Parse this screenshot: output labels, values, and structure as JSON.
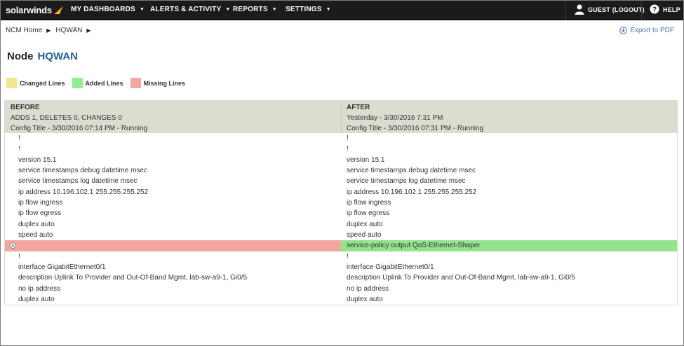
{
  "brand": {
    "name": "solarwinds"
  },
  "nav": {
    "items": [
      {
        "label": "MY DASHBOARDS"
      },
      {
        "label": "ALERTS & ACTIVITY"
      },
      {
        "label": "REPORTS"
      },
      {
        "label": "SETTINGS"
      }
    ],
    "user_label": "GUEST (LOGOUT)",
    "help_label": "HELP"
  },
  "breadcrumb": [
    "NCM Home",
    "HQWAN"
  ],
  "export_label": "Export to PDF",
  "page": {
    "title_prefix": "Node",
    "node_name": "HQWAN"
  },
  "legend": [
    {
      "label": "Changed Lines",
      "color": "#f0e68c"
    },
    {
      "label": "Added Lines",
      "color": "#90ee90"
    },
    {
      "label": "Missing Lines",
      "color": "#f4a6a6"
    }
  ],
  "diff": {
    "before": {
      "title": "BEFORE",
      "summary": "ADDS 1, DELETES 0, CHANGES 0",
      "config": "Config Title - 3/30/2016 07:14 PM - Running"
    },
    "after": {
      "title": "AFTER",
      "summary": "Yesterday - 3/30/2016 7:31 PM",
      "config": "Config Title - 3/30/2016 07:31 PM - Running"
    },
    "rows": [
      {
        "left": "!",
        "right": "!"
      },
      {
        "left": "!",
        "right": "!"
      },
      {
        "left": "version 15.1",
        "right": "version 15.1"
      },
      {
        "left": "service timestamps debug datetime msec",
        "right": "service timestamps debug datetime msec"
      },
      {
        "left": "service timestamps log datetime msec",
        "right": "service timestamps log datetime msec"
      },
      {
        "left": "ip address 10.196.102.1 255.255.255.252",
        "right": "ip address 10.196.102.1 255.255.255.252"
      },
      {
        "left": "ip flow ingress",
        "right": "ip flow ingress"
      },
      {
        "left": "ip flow egress",
        "right": "ip flow egress"
      },
      {
        "left": "duplex auto",
        "right": "duplex auto"
      },
      {
        "left": "speed auto",
        "right": "speed auto"
      },
      {
        "left": "",
        "right": "service-policy output QoS-Ethernet-Shaper",
        "changed": true
      },
      {
        "left": "!",
        "right": "!"
      },
      {
        "left": "interface GigabitEthernet0/1",
        "right": "interface GigabitEthernet0/1"
      },
      {
        "left": "description Uplink To Provider and Out-Of-Band Mgmt, lab-sw-a9-1, Gi0/5",
        "right": "description Uplink To Provider and Out-Of-Band Mgmt, lab-sw-a9-1, Gi0/5"
      },
      {
        "left": "no ip address",
        "right": "no ip address"
      },
      {
        "left": "duplex auto",
        "right": "duplex auto"
      }
    ]
  },
  "colors": {
    "missing_row": "#f3a5a0",
    "added_row": "#93e28c",
    "header_bg": "#dcdcd0",
    "node_name": "#1f5f95"
  }
}
